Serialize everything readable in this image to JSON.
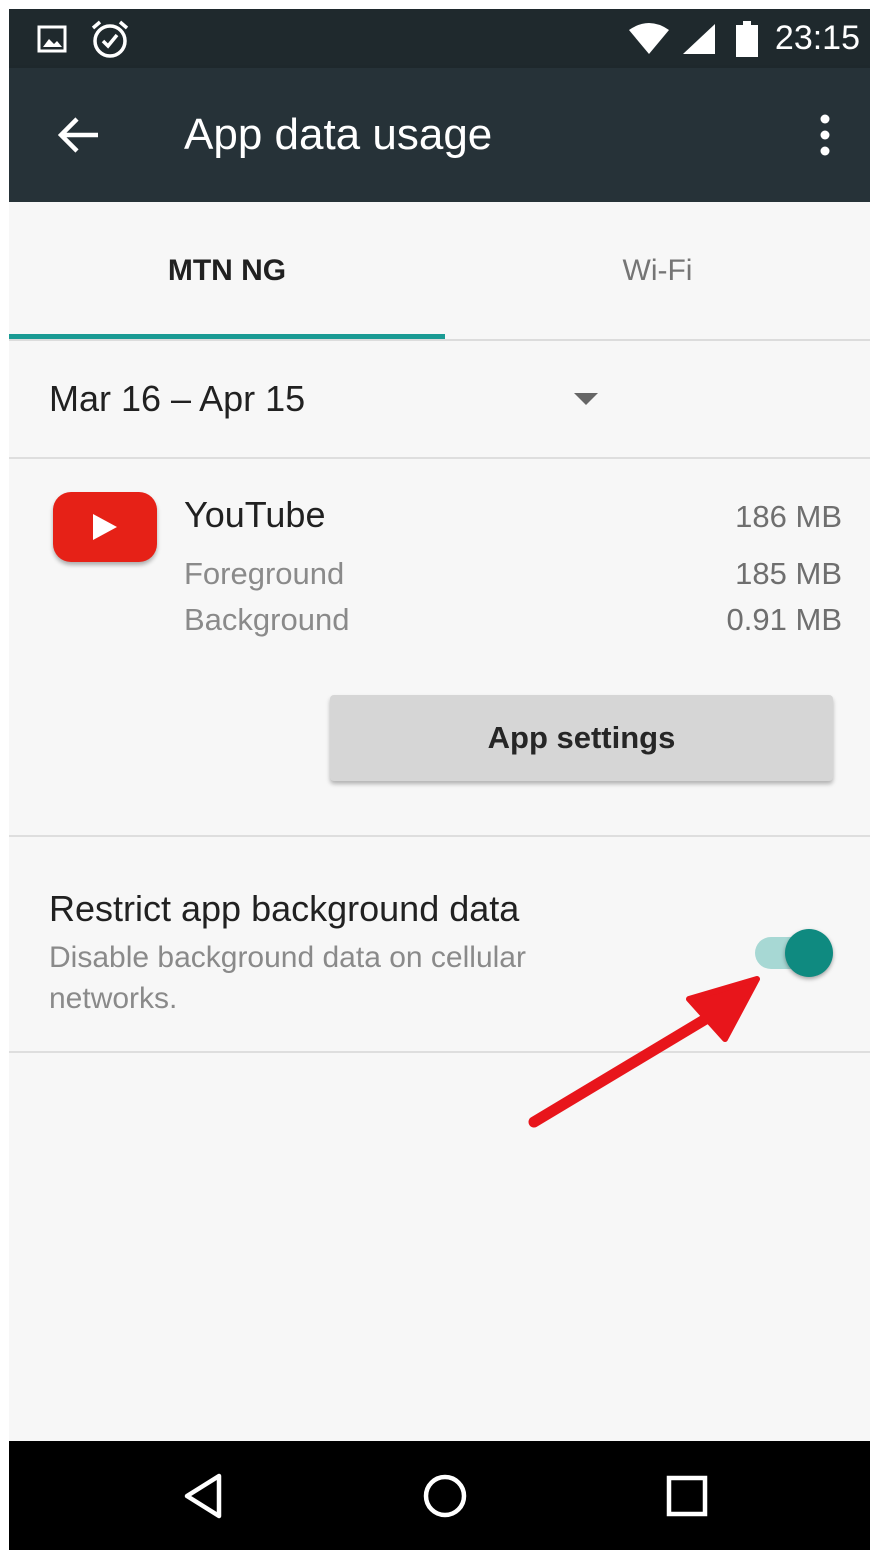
{
  "status_bar": {
    "time": "23:15",
    "icons": [
      "image-notification-icon",
      "alarm-icon",
      "wifi-icon",
      "cell-signal-icon",
      "battery-icon"
    ]
  },
  "toolbar": {
    "title": "App data usage",
    "back_icon": "arrow-back-icon",
    "more_icon": "more-vert-icon"
  },
  "tabs": [
    {
      "label": "MTN NG",
      "selected": true
    },
    {
      "label": "Wi-Fi",
      "selected": false
    }
  ],
  "cycle": {
    "range": "Mar 16 – Apr 15",
    "icon": "dropdown-arrow-icon"
  },
  "app": {
    "name": "YouTube",
    "total": "186 MB",
    "rows": [
      {
        "label": "Foreground",
        "value": "185 MB"
      },
      {
        "label": "Background",
        "value": "0.91 MB"
      }
    ],
    "settings_button": "App settings"
  },
  "restrict": {
    "title": "Restrict app background data",
    "subtitle": "Disable background data on cellular networks.",
    "enabled": true
  },
  "nav": {
    "icons": [
      "nav-back-icon",
      "nav-home-icon",
      "nav-recents-icon"
    ]
  },
  "colors": {
    "toolbar": "#263238",
    "status_bar": "#1f292d",
    "accent": "#1a9b94",
    "switch_thumb": "#0f8a80",
    "switch_track": "#a7d8d4",
    "annotation": "#e8151b",
    "youtube_red": "#e62117"
  }
}
